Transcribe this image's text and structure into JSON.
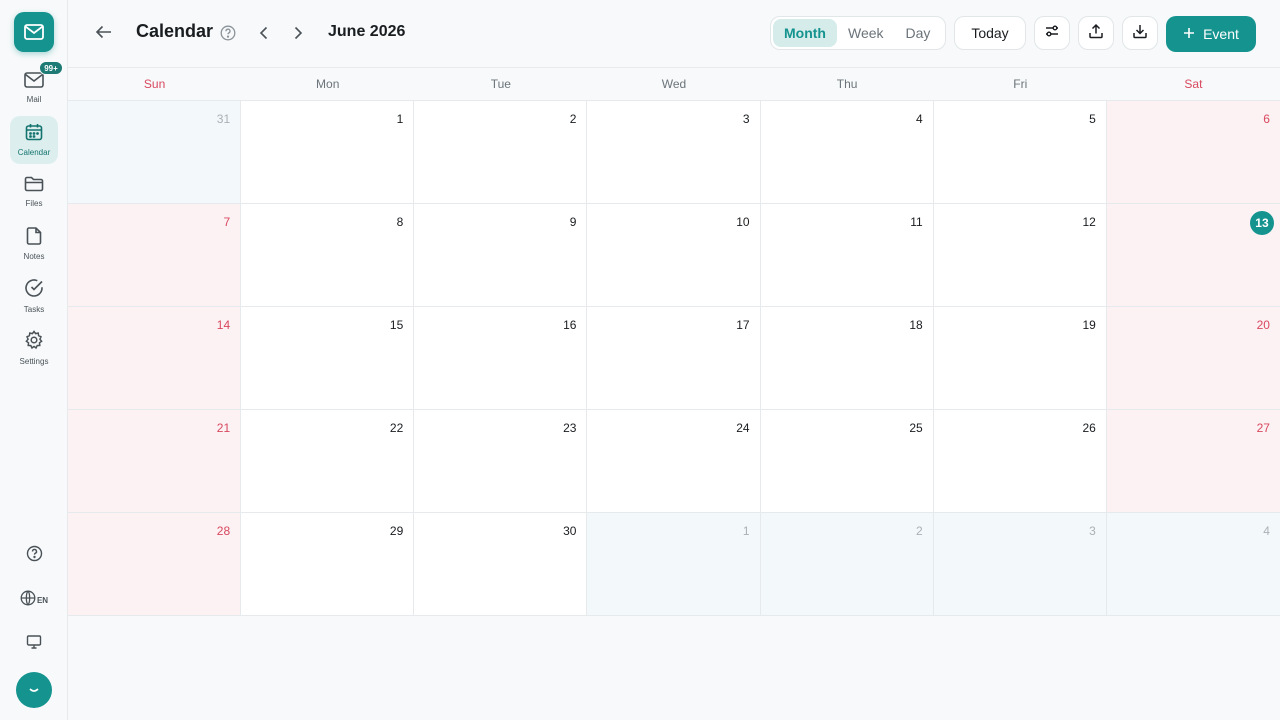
{
  "sidebar": {
    "mail_badge": "99+",
    "items": [
      {
        "label": "Mail",
        "icon": "mail-icon"
      },
      {
        "label": "Calendar",
        "icon": "calendar-icon"
      },
      {
        "label": "Files",
        "icon": "folder-icon"
      },
      {
        "label": "Notes",
        "icon": "note-icon"
      },
      {
        "label": "Tasks",
        "icon": "check-circle-icon"
      },
      {
        "label": "Settings",
        "icon": "gear-icon"
      }
    ],
    "language": "EN"
  },
  "header": {
    "title": "Calendar",
    "month_label": "June 2026",
    "views": [
      "Month",
      "Week",
      "Day"
    ],
    "active_view": "Month",
    "today_label": "Today",
    "new_event_label": "Event"
  },
  "calendar": {
    "weekdays": [
      "Sun",
      "Mon",
      "Tue",
      "Wed",
      "Thu",
      "Fri",
      "Sat"
    ],
    "today": 13,
    "weeks": [
      [
        {
          "d": "31",
          "other": true
        },
        {
          "d": "1"
        },
        {
          "d": "2"
        },
        {
          "d": "3"
        },
        {
          "d": "4"
        },
        {
          "d": "5"
        },
        {
          "d": "6"
        }
      ],
      [
        {
          "d": "7"
        },
        {
          "d": "8"
        },
        {
          "d": "9"
        },
        {
          "d": "10"
        },
        {
          "d": "11"
        },
        {
          "d": "12"
        },
        {
          "d": "13"
        }
      ],
      [
        {
          "d": "14"
        },
        {
          "d": "15"
        },
        {
          "d": "16"
        },
        {
          "d": "17"
        },
        {
          "d": "18"
        },
        {
          "d": "19"
        },
        {
          "d": "20"
        }
      ],
      [
        {
          "d": "21"
        },
        {
          "d": "22"
        },
        {
          "d": "23"
        },
        {
          "d": "24"
        },
        {
          "d": "25"
        },
        {
          "d": "26"
        },
        {
          "d": "27"
        }
      ],
      [
        {
          "d": "28"
        },
        {
          "d": "29"
        },
        {
          "d": "30"
        },
        {
          "d": "1",
          "other": true
        },
        {
          "d": "2",
          "other": true
        },
        {
          "d": "3",
          "other": true
        },
        {
          "d": "4",
          "other": true
        }
      ]
    ]
  },
  "colors": {
    "accent": "#14938f",
    "weekend_text": "#d8485f",
    "weekend_bg": "#fcf1f3",
    "other_month_bg": "#f3f8fa"
  }
}
